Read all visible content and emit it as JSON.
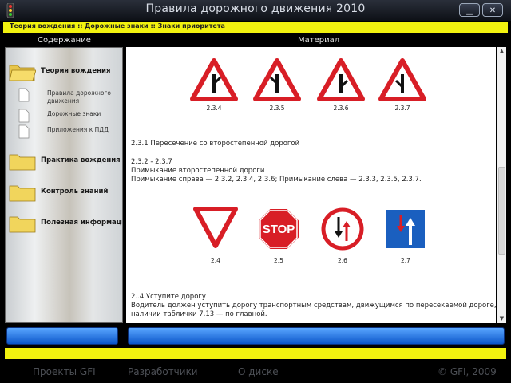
{
  "window": {
    "title": "Правила дорожного движения 2010",
    "minimize_glyph": "▁",
    "close_glyph": "✕"
  },
  "breadcrumb": "Теория вождения :: Дорожные знаки :: Знаки приоритета",
  "headers": {
    "left": "Содержание",
    "right": "Материал"
  },
  "sidebar": {
    "items": [
      {
        "label": "Теория вождения",
        "icon": "folder-open-icon"
      },
      {
        "label": "Практика вождения",
        "icon": "folder-icon"
      },
      {
        "label": "Контроль знаний",
        "icon": "folder-icon"
      },
      {
        "label": "Полезная информация",
        "icon": "folder-icon"
      }
    ],
    "subitems": [
      {
        "label": "Правила дорожного движения"
      },
      {
        "label": "Дорожные знаки"
      },
      {
        "label": "Приложения к ПДД"
      }
    ]
  },
  "content": {
    "row1_captions": [
      "2.3.4",
      "2.3.5",
      "2.3.6",
      "2.3.7"
    ],
    "p1": "2.3.1 Пересечение со второстепенной дорогой",
    "p2_title": "2.3.2 - 2.3.7",
    "p2_line1": "Примыкание второстепенной дороги",
    "p2_line2": "Примыкание справа — 2.3.2, 2.3.4, 2.3.6; Примыкание слева — 2.3.3, 2.3.5, 2.3.7.",
    "row2_captions": [
      "2.4",
      "2.5",
      "2.6",
      "2.7"
    ],
    "stop_text": "STOP",
    "p3_title": "2..4 Уступите дорогу",
    "p3_line1": "Водитель должен уступить дорогу транспортным средствам, движущимся по пересекаемой дороге, а при",
    "p3_line2": "наличии таблички 7.13 — по главной."
  },
  "footer": {
    "links": [
      "Проекты GFI",
      "Разработчики",
      "О диске"
    ],
    "copyright": "© GFI, 2009"
  },
  "colors": {
    "accent_yellow": "#f2f20f",
    "sign_red": "#d81e26",
    "sign_blue": "#1a5fbf"
  }
}
